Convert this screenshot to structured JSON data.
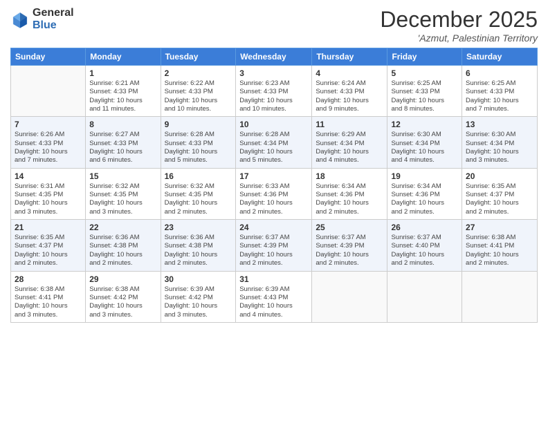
{
  "header": {
    "logo_general": "General",
    "logo_blue": "Blue",
    "month_title": "December 2025",
    "location": "'Azmut, Palestinian Territory"
  },
  "days_of_week": [
    "Sunday",
    "Monday",
    "Tuesday",
    "Wednesday",
    "Thursday",
    "Friday",
    "Saturday"
  ],
  "weeks": [
    [
      {
        "day": "",
        "info": ""
      },
      {
        "day": "1",
        "info": "Sunrise: 6:21 AM\nSunset: 4:33 PM\nDaylight: 10 hours\nand 11 minutes."
      },
      {
        "day": "2",
        "info": "Sunrise: 6:22 AM\nSunset: 4:33 PM\nDaylight: 10 hours\nand 10 minutes."
      },
      {
        "day": "3",
        "info": "Sunrise: 6:23 AM\nSunset: 4:33 PM\nDaylight: 10 hours\nand 10 minutes."
      },
      {
        "day": "4",
        "info": "Sunrise: 6:24 AM\nSunset: 4:33 PM\nDaylight: 10 hours\nand 9 minutes."
      },
      {
        "day": "5",
        "info": "Sunrise: 6:25 AM\nSunset: 4:33 PM\nDaylight: 10 hours\nand 8 minutes."
      },
      {
        "day": "6",
        "info": "Sunrise: 6:25 AM\nSunset: 4:33 PM\nDaylight: 10 hours\nand 7 minutes."
      }
    ],
    [
      {
        "day": "7",
        "info": "Sunrise: 6:26 AM\nSunset: 4:33 PM\nDaylight: 10 hours\nand 7 minutes."
      },
      {
        "day": "8",
        "info": "Sunrise: 6:27 AM\nSunset: 4:33 PM\nDaylight: 10 hours\nand 6 minutes."
      },
      {
        "day": "9",
        "info": "Sunrise: 6:28 AM\nSunset: 4:33 PM\nDaylight: 10 hours\nand 5 minutes."
      },
      {
        "day": "10",
        "info": "Sunrise: 6:28 AM\nSunset: 4:34 PM\nDaylight: 10 hours\nand 5 minutes."
      },
      {
        "day": "11",
        "info": "Sunrise: 6:29 AM\nSunset: 4:34 PM\nDaylight: 10 hours\nand 4 minutes."
      },
      {
        "day": "12",
        "info": "Sunrise: 6:30 AM\nSunset: 4:34 PM\nDaylight: 10 hours\nand 4 minutes."
      },
      {
        "day": "13",
        "info": "Sunrise: 6:30 AM\nSunset: 4:34 PM\nDaylight: 10 hours\nand 3 minutes."
      }
    ],
    [
      {
        "day": "14",
        "info": "Sunrise: 6:31 AM\nSunset: 4:35 PM\nDaylight: 10 hours\nand 3 minutes."
      },
      {
        "day": "15",
        "info": "Sunrise: 6:32 AM\nSunset: 4:35 PM\nDaylight: 10 hours\nand 3 minutes."
      },
      {
        "day": "16",
        "info": "Sunrise: 6:32 AM\nSunset: 4:35 PM\nDaylight: 10 hours\nand 2 minutes."
      },
      {
        "day": "17",
        "info": "Sunrise: 6:33 AM\nSunset: 4:36 PM\nDaylight: 10 hours\nand 2 minutes."
      },
      {
        "day": "18",
        "info": "Sunrise: 6:34 AM\nSunset: 4:36 PM\nDaylight: 10 hours\nand 2 minutes."
      },
      {
        "day": "19",
        "info": "Sunrise: 6:34 AM\nSunset: 4:36 PM\nDaylight: 10 hours\nand 2 minutes."
      },
      {
        "day": "20",
        "info": "Sunrise: 6:35 AM\nSunset: 4:37 PM\nDaylight: 10 hours\nand 2 minutes."
      }
    ],
    [
      {
        "day": "21",
        "info": "Sunrise: 6:35 AM\nSunset: 4:37 PM\nDaylight: 10 hours\nand 2 minutes."
      },
      {
        "day": "22",
        "info": "Sunrise: 6:36 AM\nSunset: 4:38 PM\nDaylight: 10 hours\nand 2 minutes."
      },
      {
        "day": "23",
        "info": "Sunrise: 6:36 AM\nSunset: 4:38 PM\nDaylight: 10 hours\nand 2 minutes."
      },
      {
        "day": "24",
        "info": "Sunrise: 6:37 AM\nSunset: 4:39 PM\nDaylight: 10 hours\nand 2 minutes."
      },
      {
        "day": "25",
        "info": "Sunrise: 6:37 AM\nSunset: 4:39 PM\nDaylight: 10 hours\nand 2 minutes."
      },
      {
        "day": "26",
        "info": "Sunrise: 6:37 AM\nSunset: 4:40 PM\nDaylight: 10 hours\nand 2 minutes."
      },
      {
        "day": "27",
        "info": "Sunrise: 6:38 AM\nSunset: 4:41 PM\nDaylight: 10 hours\nand 2 minutes."
      }
    ],
    [
      {
        "day": "28",
        "info": "Sunrise: 6:38 AM\nSunset: 4:41 PM\nDaylight: 10 hours\nand 3 minutes."
      },
      {
        "day": "29",
        "info": "Sunrise: 6:38 AM\nSunset: 4:42 PM\nDaylight: 10 hours\nand 3 minutes."
      },
      {
        "day": "30",
        "info": "Sunrise: 6:39 AM\nSunset: 4:42 PM\nDaylight: 10 hours\nand 3 minutes."
      },
      {
        "day": "31",
        "info": "Sunrise: 6:39 AM\nSunset: 4:43 PM\nDaylight: 10 hours\nand 4 minutes."
      },
      {
        "day": "",
        "info": ""
      },
      {
        "day": "",
        "info": ""
      },
      {
        "day": "",
        "info": ""
      }
    ]
  ]
}
